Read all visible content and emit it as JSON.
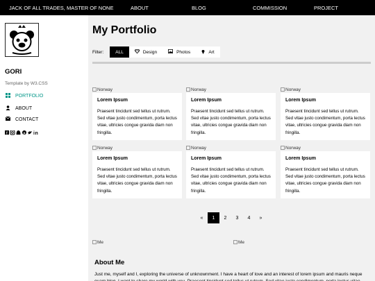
{
  "topnav": {
    "items": [
      {
        "label": "JACK OF ALL TRADES, MASTER OF NONE"
      },
      {
        "label": "ABOUT"
      },
      {
        "label": "BLOG"
      },
      {
        "label": "COMMISSION"
      },
      {
        "label": "PROJECT"
      }
    ]
  },
  "sidebar": {
    "site_name": "GORI",
    "tagline": "Template by W3.CSS",
    "items": [
      {
        "label": "PORTFOLIO",
        "icon": "grid-icon",
        "active": true
      },
      {
        "label": "ABOUT",
        "icon": "user-icon",
        "active": false
      },
      {
        "label": "CONTACT",
        "icon": "envelope-icon",
        "active": false
      }
    ],
    "social_icons": [
      "facebook-icon",
      "instagram-icon",
      "snapchat-icon",
      "pinterest-icon",
      "twitter-icon",
      "linkedin-icon"
    ]
  },
  "main": {
    "title": "My Portfolio",
    "filter": {
      "label": "Filter:",
      "buttons": [
        {
          "label": "ALL",
          "icon": "",
          "active": true
        },
        {
          "label": "Design",
          "icon": "diamond-icon",
          "active": false
        },
        {
          "label": "Photos",
          "icon": "photo-icon",
          "active": false
        },
        {
          "label": "Art",
          "icon": "map-marker-icon",
          "active": false
        }
      ]
    },
    "cards": [
      {
        "img_alt": "Norway",
        "title": "Lorem Ipsum",
        "text": "Praesent tincidunt sed tellus ut rutrum. Sed vitae justo condimentum, porta lectus vitae, ultricies congue gravida diam non fringilla."
      },
      {
        "img_alt": "Norway",
        "title": "Lorem Ipsum",
        "text": "Praesent tincidunt sed tellus ut rutrum. Sed vitae justo condimentum, porta lectus vitae, ultricies congue gravida diam non fringilla."
      },
      {
        "img_alt": "Norway",
        "title": "Lorem Ipsum",
        "text": "Praesent tincidunt sed tellus ut rutrum. Sed vitae justo condimentum, porta lectus vitae, ultricies congue gravida diam non fringilla."
      },
      {
        "img_alt": "Norway",
        "title": "Lorem Ipsum",
        "text": "Praesent tincidunt sed tellus ut rutrum. Sed vitae justo condimentum, porta lectus vitae, ultricies congue gravida diam non fringilla."
      },
      {
        "img_alt": "Norway",
        "title": "Lorem Ipsum",
        "text": "Praesent tincidunt sed tellus ut rutrum. Sed vitae justo condimentum, porta lectus vitae, ultricies congue gravida diam non fringilla."
      },
      {
        "img_alt": "Norway",
        "title": "Lorem Ipsum",
        "text": "Praesent tincidunt sed tellus ut rutrum. Sed vitae justo condimentum, porta lectus vitae, ultricies congue gravida diam non fringilla."
      }
    ],
    "pagination": {
      "prev": "«",
      "pages": [
        "1",
        "2",
        "3",
        "4"
      ],
      "current": "1",
      "next": "»"
    },
    "about": {
      "img_alts": [
        "Me",
        "Me"
      ],
      "title": "About Me",
      "text": "Just me, myself and I, exploring the universe of unknownment. I have a heart of love and an interest of lorem ipsum and mauris neque quam blog. I want to share my world with you. Praesent tincidunt sed tellus ut rutrum. Sed vitae justo condimentum, porta lectus vitae, ultricies"
    }
  },
  "colors": {
    "accent": "#009688",
    "topbar": "#000000",
    "page_bg": "#f1f1f1"
  }
}
